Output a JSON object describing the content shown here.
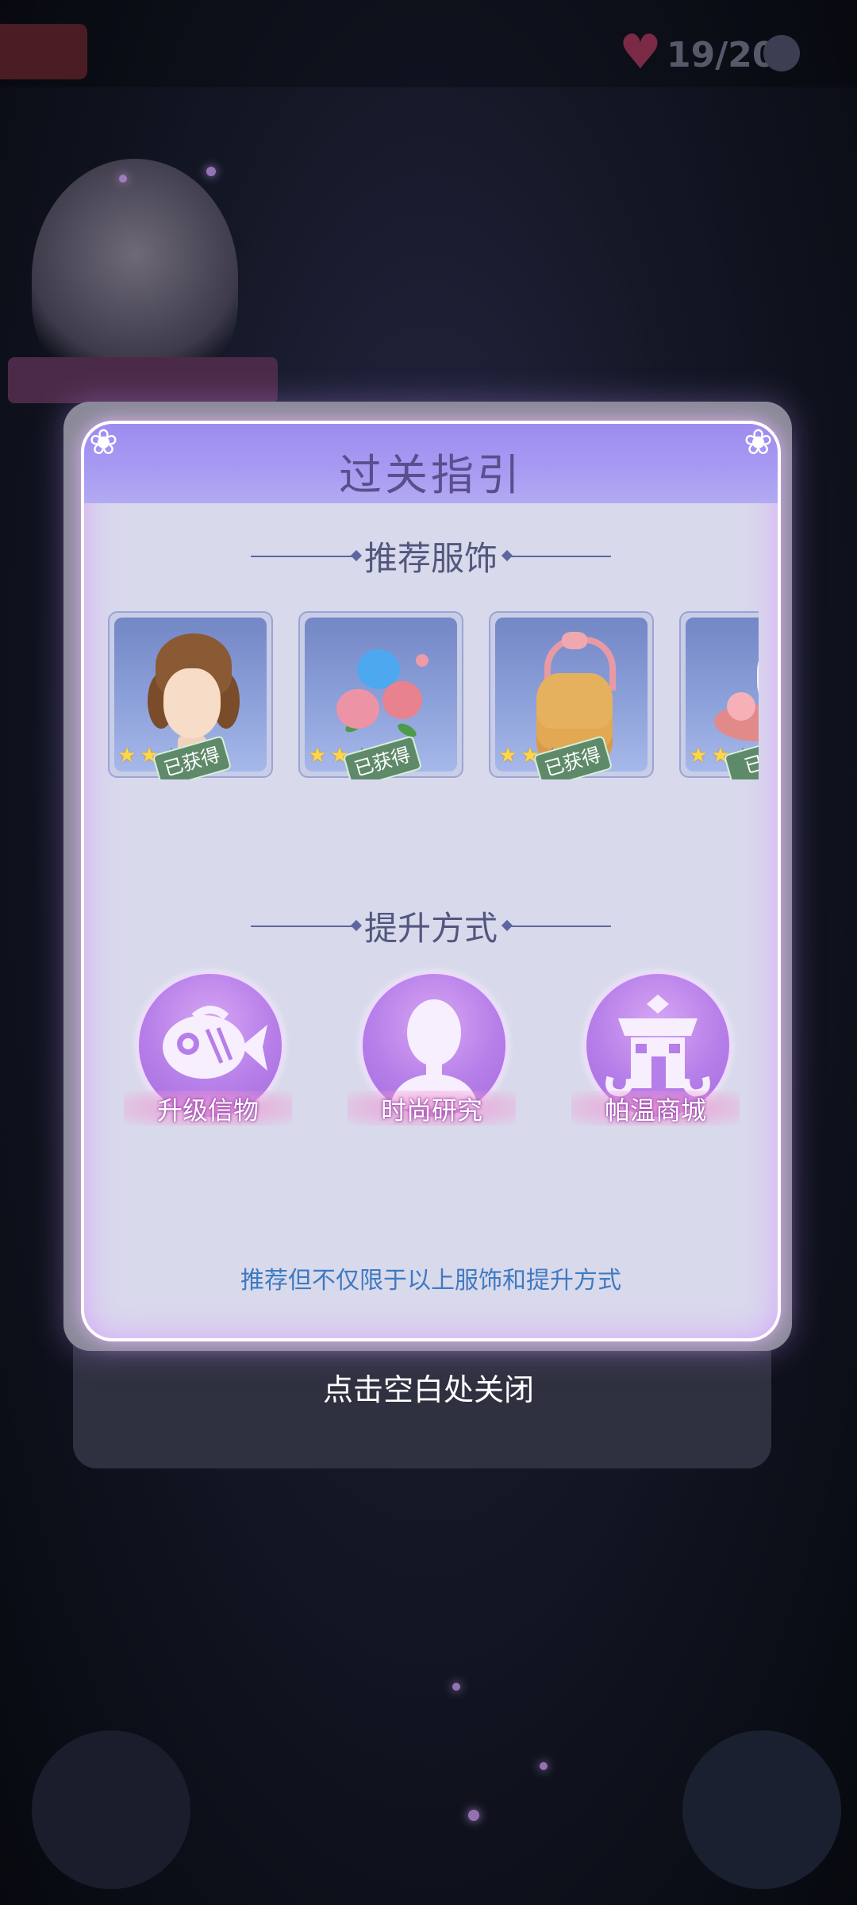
{
  "background": {
    "energy_text": "19/200"
  },
  "dialog": {
    "title": "过关指引",
    "recommended_section_title": "推荐服饰",
    "items": [
      {
        "name": "hair",
        "stars_on": 2,
        "stars_total": 5,
        "badge": "已获得"
      },
      {
        "name": "flowers",
        "stars_on": 2,
        "stars_total": 5,
        "badge": "已获得"
      },
      {
        "name": "bag",
        "stars_on": 2,
        "stars_total": 5,
        "badge": "已获得"
      },
      {
        "name": "shoe",
        "stars_on": 2,
        "stars_total": 5,
        "badge": "已获"
      }
    ],
    "improve_section_title": "提升方式",
    "methods": [
      {
        "label": "升级信物",
        "icon": "fish-icon"
      },
      {
        "label": "时尚研究",
        "icon": "silhouette-icon"
      },
      {
        "label": "帕温商城",
        "icon": "shop-icon"
      }
    ],
    "footnote": "推荐但不仅限于以上服饰和提升方式"
  },
  "close_hint": "点击空白处关闭",
  "colors": {
    "accent_purple": "#a89bf2",
    "footnote_blue": "#3e7ac2",
    "star_on": "#ffd64a",
    "badge_green": "#5f8a6a"
  }
}
